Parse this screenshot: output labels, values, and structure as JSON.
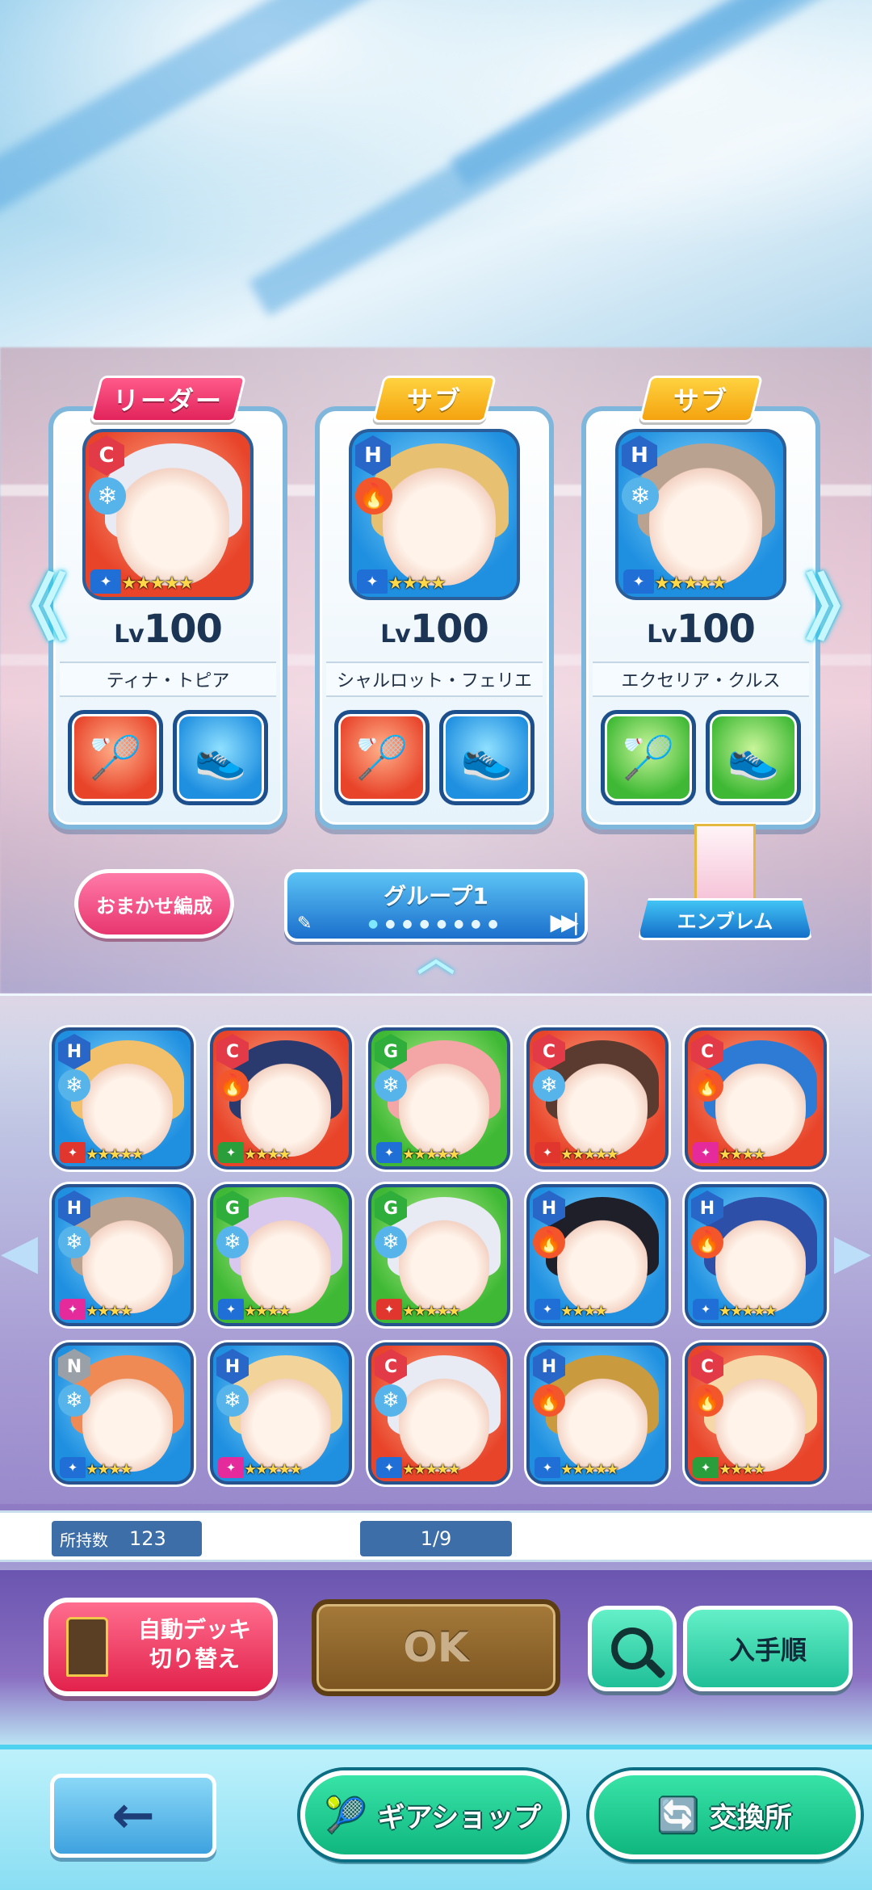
{
  "leaders": [
    {
      "tag": "リーダー",
      "tag_type": "leader",
      "rank": "C",
      "element": "ice",
      "level_prefix": "Lv",
      "level": "100",
      "name": "ティナ・トピア",
      "stars": "★★★★★",
      "bg": "red",
      "hair": "#e8eaf4"
    },
    {
      "tag": "サブ",
      "tag_type": "sub",
      "rank": "H",
      "element": "fire",
      "level_prefix": "Lv",
      "level": "100",
      "name": "シャルロット・フェリエ",
      "stars": "★★★★",
      "bg": "blue",
      "hair": "#e8c071"
    },
    {
      "tag": "サブ",
      "tag_type": "sub",
      "rank": "H",
      "element": "ice",
      "level_prefix": "Lv",
      "level": "100",
      "name": "エクセリア・クルス",
      "stars": "★★★★★",
      "bg": "blue",
      "hair": "#b9a28f"
    }
  ],
  "controls": {
    "auto_form_label": "おまかせ編成",
    "group_title": "グループ1",
    "emblem_label": "エンブレム"
  },
  "roster": [
    {
      "rank": "H",
      "element": "ice",
      "bg": "blue",
      "hair": "#f2c06a",
      "stars": "★★★★★",
      "role": "red"
    },
    {
      "rank": "C",
      "element": "fire",
      "bg": "red",
      "hair": "#2a3a6e",
      "stars": "★★★★",
      "role": "green"
    },
    {
      "rank": "G",
      "element": "ice",
      "bg": "green",
      "hair": "#f4a6a6",
      "stars": "★★★★★",
      "role": "blue"
    },
    {
      "rank": "C",
      "element": "ice",
      "bg": "red",
      "hair": "#5b3a30",
      "stars": "★★★★★",
      "role": "red"
    },
    {
      "rank": "C",
      "element": "fire",
      "bg": "red",
      "hair": "#2e7bd6",
      "stars": "★★★★",
      "role": "pink"
    },
    {
      "rank": "H",
      "element": "ice",
      "bg": "blue",
      "hair": "#b9a28f",
      "stars": "★★★★",
      "role": "pink"
    },
    {
      "rank": "G",
      "element": "ice",
      "bg": "green",
      "hair": "#d8c8ee",
      "stars": "★★★★",
      "role": "blue"
    },
    {
      "rank": "G",
      "element": "ice",
      "bg": "green",
      "hair": "#e8eaf4",
      "stars": "★★★★★",
      "role": "red"
    },
    {
      "rank": "H",
      "element": "fire",
      "bg": "blue",
      "hair": "#1f1f2a",
      "stars": "★★★★",
      "role": "blue"
    },
    {
      "rank": "H",
      "element": "fire",
      "bg": "blue",
      "hair": "#2d4fa8",
      "stars": "★★★★★",
      "role": "blue"
    },
    {
      "rank": "N",
      "element": "ice",
      "bg": "blue",
      "hair": "#f08a55",
      "stars": "★★★★",
      "role": "blue"
    },
    {
      "rank": "H",
      "element": "ice",
      "bg": "blue",
      "hair": "#f2d49a",
      "stars": "★★★★★",
      "role": "pink"
    },
    {
      "rank": "C",
      "element": "ice",
      "bg": "red",
      "hair": "#e8eaf4",
      "stars": "★★★★★",
      "role": "blue"
    },
    {
      "rank": "H",
      "element": "fire",
      "bg": "blue",
      "hair": "#c99b3e",
      "stars": "★★★★★",
      "role": "blue"
    },
    {
      "rank": "C",
      "element": "fire",
      "bg": "red",
      "hair": "#f5d7a8",
      "stars": "★★★★",
      "role": "green"
    }
  ],
  "counts": {
    "owned_label": "所持数",
    "owned_value": "123",
    "page": "1/9"
  },
  "actions": {
    "auto_deck_line1": "自動デッキ",
    "auto_deck_line2": "切り替え",
    "ok_label": "OK",
    "sort_label": "入手順"
  },
  "footer": {
    "gear_shop_label": "ギアショップ",
    "exchange_label": "交換所"
  },
  "icons": {
    "ice": "❄",
    "fire": "🔥",
    "back": "←",
    "prev": "《",
    "next": "》"
  }
}
